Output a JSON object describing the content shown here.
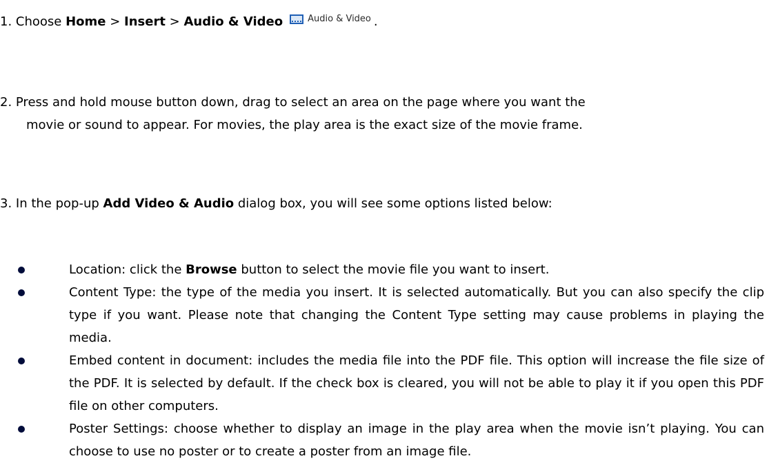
{
  "step1": {
    "prefix": "1. Choose ",
    "home": "Home",
    "sep1": " > ",
    "insert": "Insert",
    "sep2": " > ",
    "audio_video": "Audio & Video",
    "button_label": "Audio & Video",
    "button_icon": "film-icon",
    "suffix": "."
  },
  "step2": {
    "line1": "2. Press and hold mouse button down, drag to select an area on the page where you want the",
    "line2": "movie or sound to appear. For movies, the play area is the exact size of the movie frame."
  },
  "step3": {
    "prefix": "3. In the pop-up ",
    "dialog_name": "Add Video & Audio",
    "suffix": " dialog box, you will see some options listed below:"
  },
  "options": [
    {
      "pre": "Location: click the ",
      "bold": "Browse",
      "post": " button to select the movie file you want to insert."
    },
    {
      "pre": "Content Type: the type of the media you insert. It is selected automatically. But you can also specify the clip type if you want. Please note that changing the Content Type setting may cause problems in playing the media.",
      "bold": "",
      "post": ""
    },
    {
      "pre": "Embed content in document: includes the media file into the PDF file. This option will increase the file size of the PDF. It is selected by default. If the check box is cleared, you will not be able to play it if you open this PDF file on other computers.",
      "bold": "",
      "post": ""
    },
    {
      "pre": "Poster Settings: choose whether to display an image in the play area when the movie isn’t playing. You can choose to use no poster or to create a poster from an image file.",
      "bold": "",
      "post": ""
    }
  ],
  "colors": {
    "text": "#000000",
    "bullet": "#000c3a",
    "icon_accent": "#1f5fb5"
  }
}
